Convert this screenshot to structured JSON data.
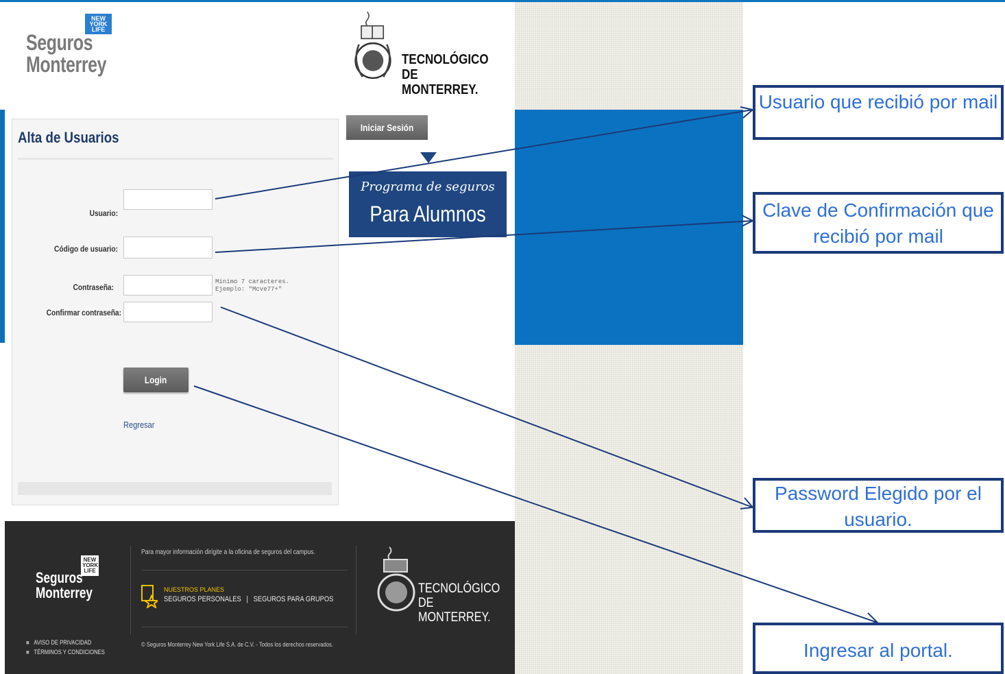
{
  "header": {
    "left_logo": {
      "line1": "Seguros",
      "line2": "Monterrey",
      "badge": [
        "NEW",
        "YORK",
        "LIFE"
      ]
    },
    "right_logo": {
      "line1": "TECNOLÓGICO",
      "line2": "DE MONTERREY."
    }
  },
  "form": {
    "title": "Alta de Usuarios",
    "usuario_label": "Usuario:",
    "codigo_label": "Código de usuario:",
    "contrasena_label": "Contraseña:",
    "confirmar_label": "Confirmar contraseña:",
    "hint_line1": "Mínimo 7 caracteres.",
    "hint_line2": "Ejemplo: \"Mcve77+\"",
    "login_label": "Login",
    "regresar_label": "Regresar"
  },
  "sidebar": {
    "iniciar_label": "Iniciar Sesión",
    "promo_line1": "Programa de seguros",
    "promo_line2": "Para Alumnos"
  },
  "footer": {
    "logo_line1": "Seguros",
    "logo_line2": "Monterrey",
    "info_text": "Para mayor información dirígite a la oficina de seguros del campus.",
    "plans_label": "NUESTROS PLANES",
    "plans_personal": "SEGUROS PERSONALES",
    "plans_separator": "|",
    "plans_grupos": "SEGUROS PARA GRUPOS",
    "copyright": "© Seguros Monterrey New York Life S.A. de C.V. - Todos los derechos reservados.",
    "aviso_label": "AVISO DE PRIVACIDAD",
    "terminos_label": "TÉRMINOS Y CONDICIONES",
    "tec_line1": "TECNOLÓGICO",
    "tec_line2": "DE MONTERREY."
  },
  "annotations": {
    "usuario": "Usuario que recibió por mail",
    "clave": "Clave de Confirmación que recibió  por mail",
    "password": "Password Elegido por el usuario.",
    "ingresar": "Ingresar al portal."
  },
  "colors": {
    "accent_blue": "#0b72c1",
    "annotation_border": "#1b3a7a",
    "annotation_text": "#2f6fd8",
    "footer_bg": "#2b2b2b"
  }
}
